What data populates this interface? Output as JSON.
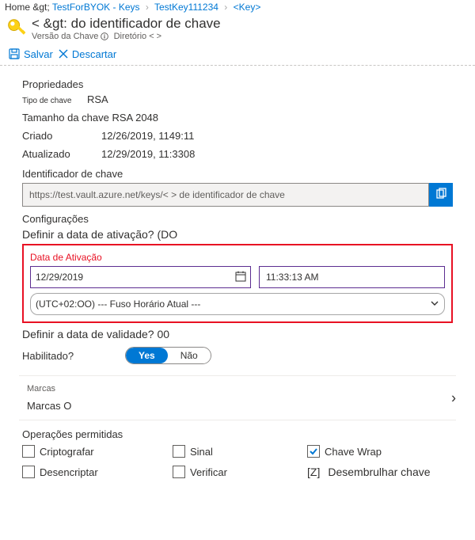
{
  "breadcrumb": {
    "home": "Home &gt;",
    "link1": "TestForBYOK - Keys",
    "link2": "TestKey111234",
    "link3": "<Key>"
  },
  "title": {
    "main": "< &gt: do identificador de chave",
    "version_label": "Versão da Chave",
    "directory": "Diretório < >"
  },
  "toolbar": {
    "save": "Salvar",
    "discard": "Descartar"
  },
  "properties": {
    "section": "Propriedades",
    "type_label": "Tipo de chave",
    "type_value": "RSA",
    "size_line": "Tamanho da chave RSA 2048",
    "created_label": "Criado",
    "created_value": "12/26/2019, 1149:11",
    "updated_label": "Atualizado",
    "updated_value": "12/29/2019, 11:3308"
  },
  "key_id": {
    "label": "Identificador de chave",
    "value": "https://test.vault.azure.net/keys/< > de identificador de chave"
  },
  "settings": {
    "section": "Configurações",
    "activation_q": "Definir a data de ativação? (DO",
    "activation_label": "Data de Ativação",
    "date_value": "12/29/2019",
    "time_value": "11:33:13 AM",
    "timezone": "(UTC+02:OO) --- Fuso Horário Atual   ---",
    "expiration_q": "Definir a data de validade? 00",
    "enabled_label": "Habilitado?",
    "toggle_yes": "Yes",
    "toggle_no": "Não"
  },
  "tags": {
    "title": "Marcas",
    "line": "Marcas O"
  },
  "ops": {
    "title": "Operações permitidas",
    "encrypt": "Criptografar",
    "sign": "Sinal",
    "wrap": "Chave Wrap",
    "decrypt": "Desencriptar",
    "verify": "Verificar",
    "unwrap_prefix": "[Z]",
    "unwrap": "Desembrulhar chave"
  }
}
